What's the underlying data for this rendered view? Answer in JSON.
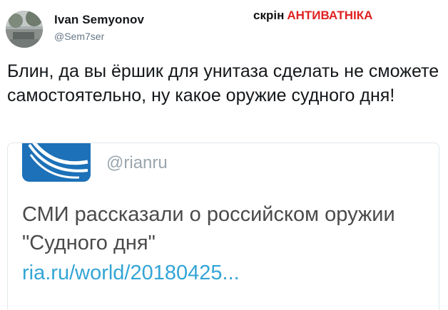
{
  "tweet": {
    "author_name": "Ivan Semyonov",
    "author_handle": "@Sem7ser",
    "text": "Блин, да вы ёршик для унитаза сделать не сможете самостоятельно, ну какое оружие судного дня!"
  },
  "watermark": {
    "prefix": "скрін",
    "name": "АНТИВАТНІКА",
    "name_color": "#e02020"
  },
  "embedded_card": {
    "source_handle": "@rianru",
    "headline": "СМИ рассказали о российском оружии \"Судного дня\"",
    "link_text": "ria.ru/world/20180425...",
    "link_color": "#33a5d6",
    "logo_icon": "ria-novosti-logo-icon"
  }
}
